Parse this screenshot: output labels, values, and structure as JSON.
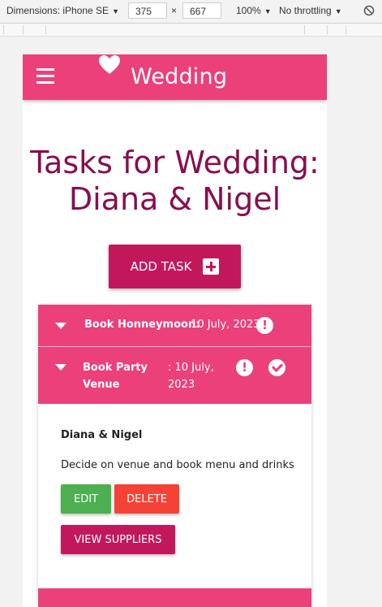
{
  "devtools": {
    "dimensions_label": "Dimensions: iPhone SE",
    "width": "375",
    "times": "×",
    "height": "667",
    "zoom": "100%",
    "throttling": "No throttling"
  },
  "app": {
    "brand": "Wedding",
    "page_title": "Tasks for Wedding: Diana & Nigel",
    "add_task_label": "ADD TASK"
  },
  "tasks": [
    {
      "name": "Book Honneymoon:",
      "date": " 10 July, 2023",
      "alert": "!"
    },
    {
      "name_line1": "Book Party",
      "name_line2": "Venue",
      "date_line1": ": 10 July,",
      "date_line2": "2023",
      "alert": "!",
      "expanded": true,
      "owner": "Diana & Nigel",
      "description": "Decide on venue and book menu and drinks",
      "edit_label": "EDIT",
      "delete_label": "DELETE",
      "suppliers_label": "VIEW SUPPLIERS"
    }
  ],
  "colors": {
    "primary": "#ec407a",
    "accent": "#c2185b",
    "title": "#880e4f",
    "edit": "#4caf50",
    "delete": "#f44336"
  },
  "icons": [
    "menu-icon",
    "heart-icon",
    "plus-square-icon",
    "chevron-down-icon",
    "alert-circle-icon",
    "check-circle-icon",
    "block-icon"
  ]
}
